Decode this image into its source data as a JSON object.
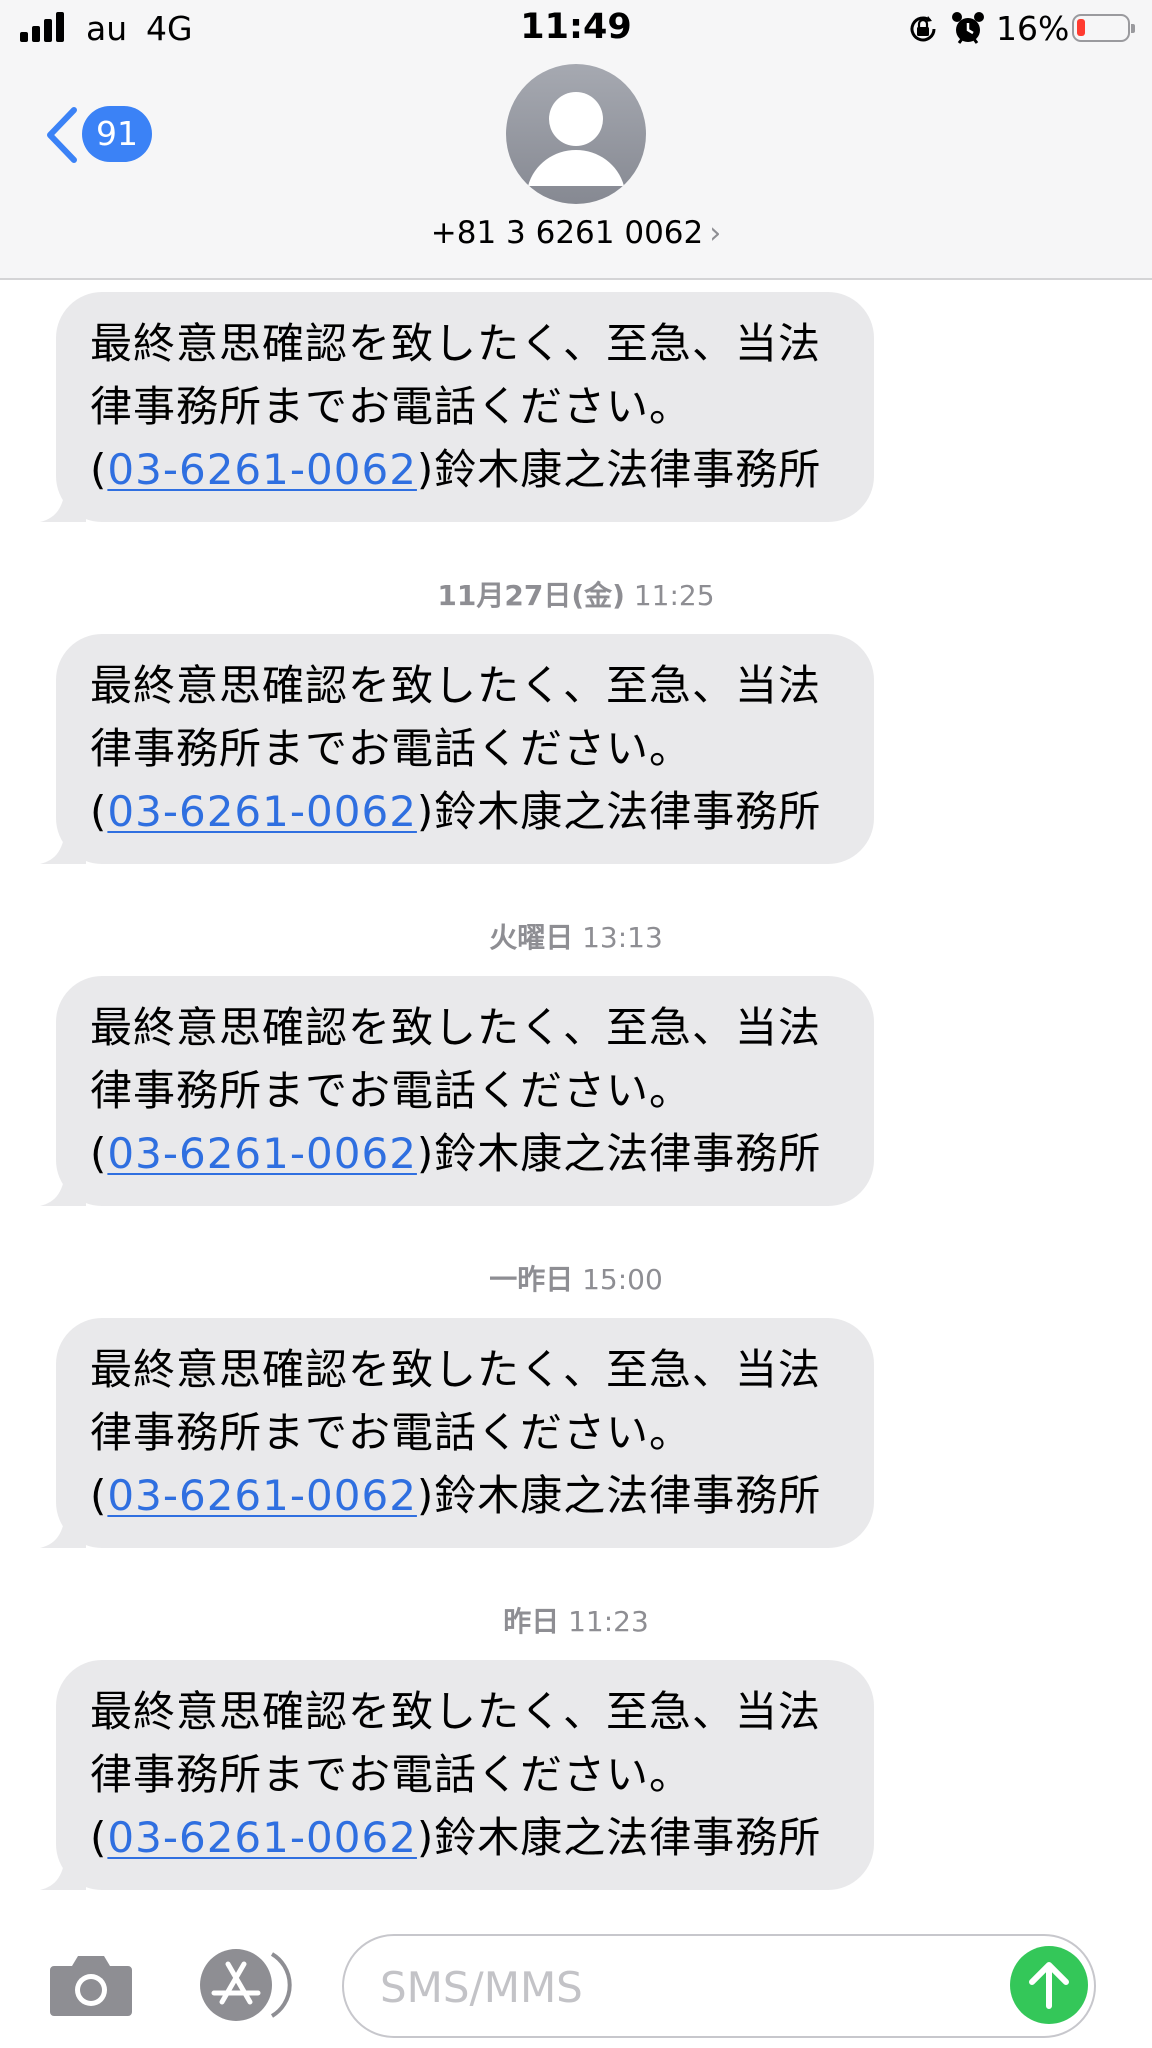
{
  "status_bar": {
    "carrier": "au",
    "network": "4G",
    "time": "11:49",
    "battery_percent": "16%",
    "battery_level": 0.16,
    "battery_color": "#ff3b30"
  },
  "header": {
    "back_badge": "91",
    "contact_number": "+81 3 6261 0062",
    "contact_chevron": "›",
    "avatar_icon": "person-silhouette-icon"
  },
  "messages": [
    {
      "timestamp_day": "",
      "timestamp_time": "",
      "line1": "最終意思確認を致したく、至急、当法",
      "line2": "律事務所までお電話ください。",
      "prefix": "(",
      "phone": "03-6261-0062",
      "suffix": ")鈴木康之法律事務所"
    },
    {
      "timestamp_day": "11月27日(金)",
      "timestamp_time": "11:25",
      "line1": "最終意思確認を致したく、至急、当法",
      "line2": "律事務所までお電話ください。",
      "prefix": "(",
      "phone": "03-6261-0062",
      "suffix": ")鈴木康之法律事務所"
    },
    {
      "timestamp_day": "火曜日",
      "timestamp_time": "13:13",
      "line1": "最終意思確認を致したく、至急、当法",
      "line2": "律事務所までお電話ください。",
      "prefix": "(",
      "phone": "03-6261-0062",
      "suffix": ")鈴木康之法律事務所"
    },
    {
      "timestamp_day": "一昨日",
      "timestamp_time": "15:00",
      "line1": "最終意思確認を致したく、至急、当法",
      "line2": "律事務所までお電話ください。",
      "prefix": "(",
      "phone": "03-6261-0062",
      "suffix": ")鈴木康之法律事務所"
    },
    {
      "timestamp_day": "昨日",
      "timestamp_time": "11:23",
      "line1": "最終意思確認を致したく、至急、当法",
      "line2": "律事務所までお電話ください。",
      "prefix": "(",
      "phone": "03-6261-0062",
      "suffix": ")鈴木康之法律事務所"
    }
  ],
  "input_bar": {
    "placeholder": "SMS/MMS",
    "camera_icon": "camera-icon",
    "apps_icon": "app-store-icon",
    "send_icon": "send-arrow-icon",
    "send_color": "#34c759"
  },
  "colors": {
    "link": "#2f6fe0",
    "bubble": "#e9e9eb",
    "badge": "#3b82f6",
    "header_bg": "#f6f6f7"
  }
}
